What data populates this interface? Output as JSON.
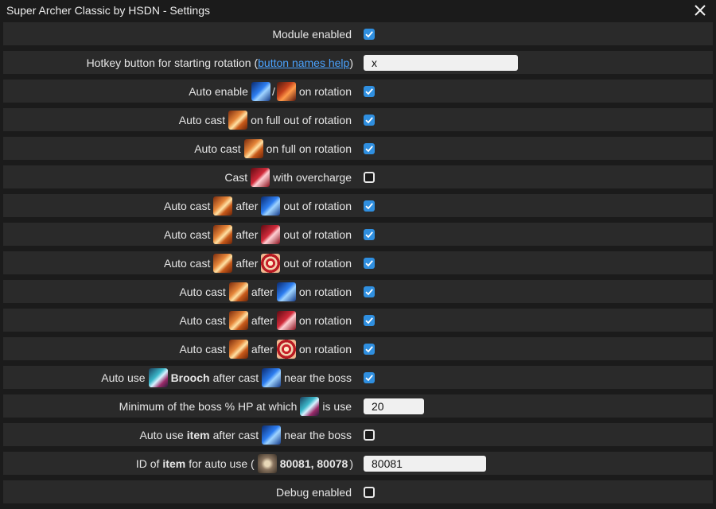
{
  "window": {
    "title": "Super Archer Classic by HSDN - Settings",
    "close_icon": "close-icon"
  },
  "colors": {
    "accent": "#2f8fe0",
    "link": "#4aa3ff",
    "row_bg": "#2a2a2a",
    "window_bg": "#1b1b1b"
  },
  "settings": {
    "module": {
      "label": "Module enabled",
      "checked": true
    },
    "hotkey": {
      "label_pre": "Hotkey button for starting rotation (",
      "link": "button names help",
      "label_post": ")",
      "value": "x"
    },
    "auto_enable": {
      "t1": "Auto enable",
      "sep": "/",
      "t2": "on rotation",
      "checked": true,
      "icons": [
        "blue-swirl-skill-icon",
        "fire-burst-skill-icon"
      ]
    },
    "cast_full_out": {
      "t1": "Auto cast",
      "t2": "on full out of rotation",
      "checked": true,
      "icon": "arrow-skill-icon"
    },
    "cast_full_on": {
      "t1": "Auto cast",
      "t2": "on full on rotation",
      "checked": true,
      "icon": "arrow-skill-icon"
    },
    "overcharge": {
      "t1": "Cast",
      "t2": "with overcharge",
      "checked": false,
      "icon": "red-claw-skill-icon"
    },
    "after_blue_out": {
      "t1": "Auto cast",
      "t2": "after",
      "t3": "out of rotation",
      "checked": true
    },
    "after_red_out": {
      "t1": "Auto cast",
      "t2": "after",
      "t3": "out of rotation",
      "checked": true
    },
    "after_target_out": {
      "t1": "Auto cast",
      "t2": "after",
      "t3": "out of rotation",
      "checked": true
    },
    "after_blue_on": {
      "t1": "Auto cast",
      "t2": "after",
      "t3": "on rotation",
      "checked": true
    },
    "after_red_on": {
      "t1": "Auto cast",
      "t2": "after",
      "t3": "on rotation",
      "checked": true
    },
    "after_target_on": {
      "t1": "Auto cast",
      "t2": "after",
      "t3": "on rotation",
      "checked": true
    },
    "brooch": {
      "t1": "Auto use",
      "bold": "Brooch",
      "t2": "after cast",
      "t3": "near the boss",
      "checked": true
    },
    "min_hp": {
      "t1": "Minimum of the boss % HP at which",
      "t2": "is use",
      "value": "20"
    },
    "item_use": {
      "t1": "Auto use",
      "bold": "item",
      "t2": "after cast",
      "t3": "near the boss",
      "checked": false
    },
    "item_id": {
      "t1": "ID of",
      "bold": "item",
      "t2": "for auto use (",
      "bold2": "80081, 80078",
      "t3": ")",
      "value": "80081"
    },
    "debug": {
      "label": "Debug enabled",
      "checked": false
    }
  }
}
